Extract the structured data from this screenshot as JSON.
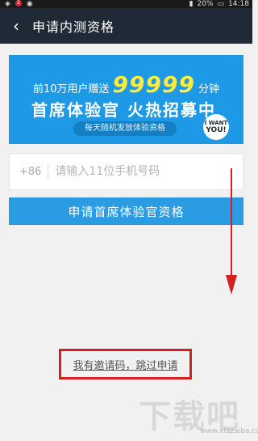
{
  "status_bar": {
    "notification_badge": "2",
    "battery": "20%",
    "time": "14:18"
  },
  "app_bar": {
    "back_symbol": "‹",
    "title": "申请内测资格"
  },
  "banner": {
    "line1_prefix": "前10万用户赠送",
    "line1_big": "99999",
    "line1_suffix": "分钟",
    "line2": "首席体验官 火热招募中",
    "pill": "每天随机发放体验资格",
    "badge_line1": "I WANT",
    "badge_line2": "YOU!"
  },
  "form": {
    "country_code": "+86",
    "phone_placeholder": "请输入11位手机号码",
    "apply_label": "申请首席体验官资格"
  },
  "skip_link": "我有邀请码，跳过申请",
  "watermark": {
    "text": "下载吧",
    "url": "www.xiazaiba.com"
  },
  "colors": {
    "accent": "#2b9be3",
    "banner": "#1d99e6",
    "highlight": "#ffec3d",
    "annotation": "#d32020",
    "app_bar": "#1f2a36"
  }
}
